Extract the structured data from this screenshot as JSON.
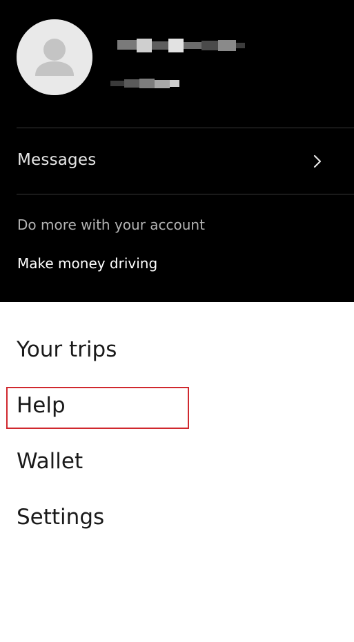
{
  "header": {
    "messages_label": "Messages",
    "section_label": "Do more with your account",
    "drive_link": "Make money driving"
  },
  "menu": {
    "items": [
      {
        "label": "Your trips"
      },
      {
        "label": "Help"
      },
      {
        "label": "Wallet"
      },
      {
        "label": "Settings"
      }
    ]
  },
  "colors": {
    "header_background": "#000000",
    "menu_background": "#ffffff",
    "highlight_border": "#d0282e"
  },
  "icons": {
    "avatar": "person-silhouette-icon",
    "messages_chevron": "chevron-right-icon"
  }
}
